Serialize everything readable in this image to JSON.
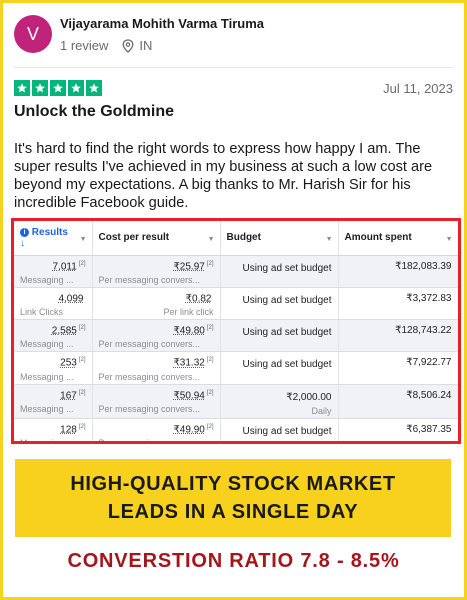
{
  "reviewer": {
    "avatar_letter": "V",
    "name": "Vijayarama Mohith Varma Tiruma",
    "reviews": "1 review",
    "country": "IN"
  },
  "review": {
    "rating": 5,
    "date": "Jul 11, 2023",
    "title": "Unlock the Goldmine",
    "body": "It's hard to find the right words to express how happy I am. The super results I've achieved in my business at such a low cost are beyond my expectations. A big thanks to Mr. Harish Sir for his incredible Facebook guide."
  },
  "table": {
    "headers": [
      "Results",
      "Cost per result",
      "Budget",
      "Amount spent"
    ],
    "sort_arrow": "↓",
    "rows": [
      {
        "results": "7,011",
        "results_sup": "[2]",
        "results_sub": "Messaging ...",
        "cost": "₹25.97",
        "cost_sup": "[2]",
        "cost_sub": "Per messaging convers...",
        "budget": "Using ad set budget",
        "budget_sub": "",
        "spent": "₹182,083.39"
      },
      {
        "results": "4,099",
        "results_sup": "",
        "results_sub": "Link Clicks",
        "cost": "₹0.82",
        "cost_sup": "",
        "cost_sub": "Per link click",
        "budget": "Using ad set budget",
        "budget_sub": "",
        "spent": "₹3,372.83"
      },
      {
        "results": "2,585",
        "results_sup": "[2]",
        "results_sub": "Messaging ...",
        "cost": "₹49.80",
        "cost_sup": "[2]",
        "cost_sub": "Per messaging convers...",
        "budget": "Using ad set budget",
        "budget_sub": "",
        "spent": "₹128,743.22"
      },
      {
        "results": "253",
        "results_sup": "[2]",
        "results_sub": "Messaging ...",
        "cost": "₹31.32",
        "cost_sup": "[2]",
        "cost_sub": "Per messaging convers...",
        "budget": "Using ad set budget",
        "budget_sub": "",
        "spent": "₹7,922.77"
      },
      {
        "results": "167",
        "results_sup": "[2]",
        "results_sub": "Messaging ...",
        "cost": "₹50.94",
        "cost_sup": "[2]",
        "cost_sub": "Per messaging convers...",
        "budget": "₹2,000.00",
        "budget_sub": "Daily",
        "spent": "₹8,506.24"
      },
      {
        "results": "128",
        "results_sup": "[2]",
        "results_sub": "Messaging ...",
        "cost": "₹49.90",
        "cost_sup": "[2]",
        "cost_sub": "Per messaging convers...",
        "budget": "Using ad set budget",
        "budget_sub": "",
        "spent": "₹6,387.35"
      }
    ]
  },
  "banner": {
    "line1": "HIGH-QUALITY STOCK MARKET",
    "line2": "LEADS IN A SINGLE DAY"
  },
  "ratio": "CONVERSTION RATIO 7.8 - 8.5%",
  "colors": {
    "frame": "#f5d21c",
    "avatar": "#c0247a",
    "stars": "#00b67a",
    "table_border": "#e8202a",
    "banner": "#f7d11e",
    "ratio_text": "#a3161c"
  }
}
